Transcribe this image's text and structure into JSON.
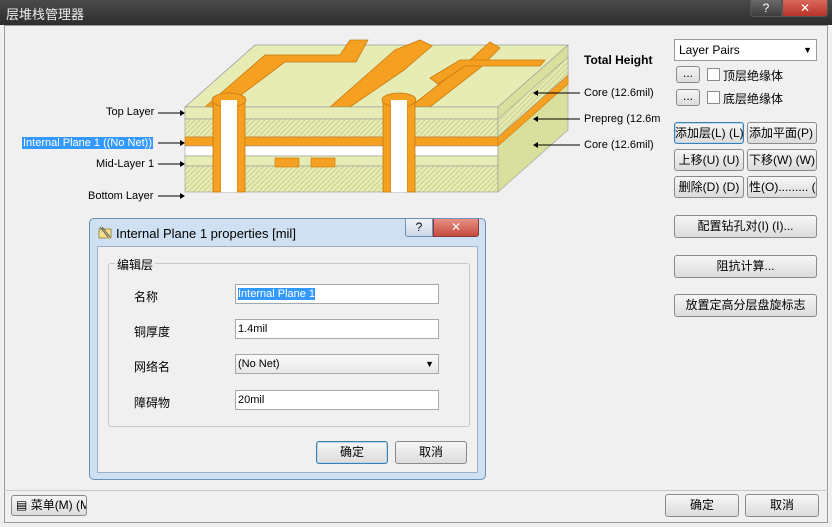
{
  "window": {
    "title": "层堆栈管理器",
    "help": "?",
    "close": "✕"
  },
  "diagram": {
    "left_labels": [
      "Top Layer",
      "Internal Plane 1 ((No Net))",
      "Mid-Layer 1",
      "Bottom Layer"
    ],
    "total_height": "Total Height",
    "right_labels": [
      "Core (12.6mil)",
      "Prepreg (12.6m",
      "Core (12.6mil)"
    ]
  },
  "right_panel": {
    "layer_pairs": "Layer Pairs",
    "top_insulation_button": "...",
    "top_insulation_label": "顶层绝缘体",
    "bottom_insulation_button": "...",
    "bottom_insulation_label": "底层绝缘体",
    "add_layer": "添加层(L) (L)",
    "add_plane": "添加平面(P) (P",
    "move_up": "上移(U) (U)",
    "move_down": "下移(W) (W)",
    "delete": "删除(D) (D)",
    "properties": "性(O)......... (O",
    "drill_pairs": "配置钻孔对(I) (I)...",
    "impedance": "阻抗计算...",
    "place_legend": "放置定高分层盘旋标志"
  },
  "dialog": {
    "title": "Internal Plane 1 properties [mil]",
    "help": "?",
    "close": "✕",
    "group_title": "编辑层",
    "fields": [
      {
        "label": "名称",
        "value": "Internal Plane 1"
      },
      {
        "label": "铜厚度",
        "value": "1.4mil"
      },
      {
        "label": "网络名",
        "value": "(No Net)"
      },
      {
        "label": "障碍物",
        "value": "20mil"
      }
    ],
    "ok": "确定",
    "cancel": "取消"
  },
  "footer": {
    "menu": "菜单(M) (M",
    "ok": "确定",
    "cancel": "取消"
  },
  "colors": {
    "copper": "#f5a020",
    "dielectric": "#e6ecb4",
    "core_hatch": "#c9d08c",
    "selection": "#3399ff"
  }
}
